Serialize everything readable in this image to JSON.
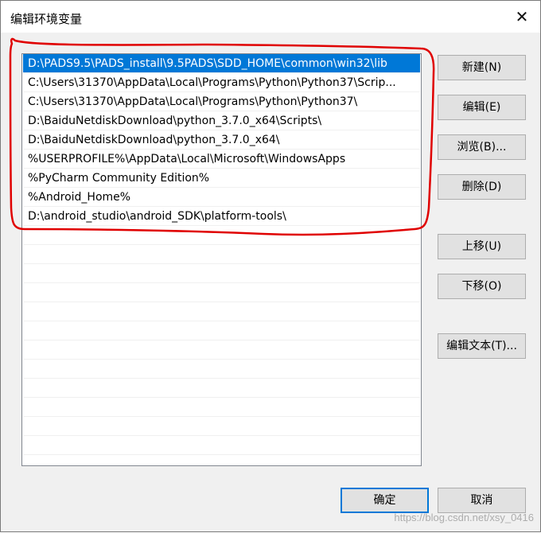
{
  "window": {
    "title": "编辑环境变量",
    "close_label": "✕"
  },
  "path_list": {
    "items": [
      {
        "text": "D:\\PADS9.5\\PADS_install\\9.5PADS\\SDD_HOME\\common\\win32\\lib",
        "selected": true
      },
      {
        "text": "C:\\Users\\31370\\AppData\\Local\\Programs\\Python\\Python37\\Scrip...",
        "selected": false
      },
      {
        "text": "C:\\Users\\31370\\AppData\\Local\\Programs\\Python\\Python37\\",
        "selected": false
      },
      {
        "text": "D:\\BaiduNetdiskDownload\\python_3.7.0_x64\\Scripts\\",
        "selected": false
      },
      {
        "text": "D:\\BaiduNetdiskDownload\\python_3.7.0_x64\\",
        "selected": false
      },
      {
        "text": "%USERPROFILE%\\AppData\\Local\\Microsoft\\WindowsApps",
        "selected": false
      },
      {
        "text": "%PyCharm Community Edition%",
        "selected": false
      },
      {
        "text": "%Android_Home%",
        "selected": false
      },
      {
        "text": "D:\\android_studio\\android_SDK\\platform-tools\\",
        "selected": false
      }
    ]
  },
  "side_buttons": {
    "new": "新建(N)",
    "edit": "编辑(E)",
    "browse": "浏览(B)...",
    "delete": "删除(D)",
    "move_up": "上移(U)",
    "move_down": "下移(O)",
    "edit_text": "编辑文本(T)..."
  },
  "footer": {
    "ok": "确定",
    "cancel": "取消"
  },
  "watermark": "https://blog.csdn.net/xsy_0416",
  "colors": {
    "selection": "#0078d7",
    "annotation": "#e00000"
  }
}
